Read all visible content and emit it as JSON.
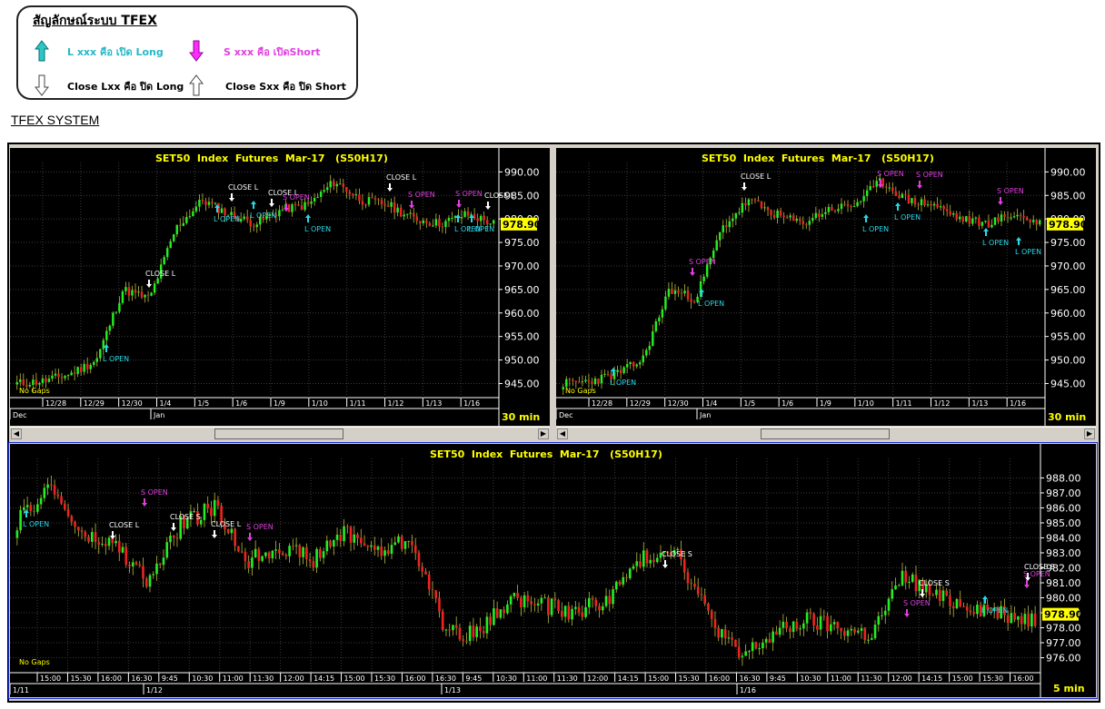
{
  "legend": {
    "title": "สัญลักษณ์ระบบ TFEX",
    "items": [
      {
        "text": "L xxx คือ เปิด Long",
        "color": "#27b8c8"
      },
      {
        "text": "S xxx คือ เปิดShort",
        "color": "#e040e0"
      },
      {
        "text": "Close Lxx คือ ปิด Long",
        "color": "#000000"
      },
      {
        "text": "Close Sxx คือ ปิด Short",
        "color": "#000000"
      }
    ],
    "icons": [
      "arrow-up-cyan-icon",
      "arrow-down-magenta-icon",
      "arrow-down-outline-icon",
      "arrow-up-outline-icon"
    ]
  },
  "section_title": "TFEX SYSTEM",
  "colors": {
    "up": "#22ee22",
    "down": "#ee2222",
    "grid": "#3a3a3a",
    "title": "#ffff00",
    "price_box": "#ffff00",
    "long": "#27d8e8",
    "short": "#e040e0",
    "close": "#ffffff"
  },
  "panels": [
    {
      "title": "SET50  Index  Futures  Mar-17   (S50H17)",
      "interval": "30  min",
      "no_gaps": "No  Gaps",
      "last_price": "978.90",
      "price_ticks": [
        "990.00",
        "985.00",
        "980.00",
        "975.00",
        "970.00",
        "965.00",
        "960.00",
        "955.00",
        "950.00",
        "945.00"
      ],
      "date_ticks": [
        "12/28",
        "12/29",
        "12/30",
        "1/4",
        "1/5",
        "1/6",
        "1/9",
        "1/10",
        "1/11",
        "1/12",
        "1/13",
        "1/16"
      ],
      "month_ticks": [
        "Dec",
        "Jan"
      ],
      "signals": [
        {
          "label": "L  OPEN",
          "type": "long"
        },
        {
          "label": "CLOSE  L",
          "type": "close"
        },
        {
          "label": "L  OPEN",
          "type": "long"
        },
        {
          "label": "CLOSE  L",
          "type": "close"
        },
        {
          "label": "L  OPEN",
          "type": "long"
        },
        {
          "label": "CLOSE  L",
          "type": "close"
        },
        {
          "label": "S  OPEN",
          "type": "short"
        },
        {
          "label": "L  OPEN",
          "type": "long"
        },
        {
          "label": "CLOSE  L",
          "type": "close"
        },
        {
          "label": "S  OPEN",
          "type": "short"
        },
        {
          "label": "S  OPEN",
          "type": "short"
        },
        {
          "label": "CLOSE  L",
          "type": "close"
        },
        {
          "label": "L  OPEN",
          "type": "long"
        },
        {
          "label": "L  OPEN",
          "type": "long"
        }
      ]
    },
    {
      "title": "SET50  Index  Futures  Mar-17   (S50H17)",
      "interval": "30  min",
      "no_gaps": "No  Gaps",
      "last_price": "978.90",
      "price_ticks": [
        "990.00",
        "985.00",
        "980.00",
        "975.00",
        "970.00",
        "965.00",
        "960.00",
        "955.00",
        "950.00",
        "945.00"
      ],
      "date_ticks": [
        "12/28",
        "12/29",
        "12/30",
        "1/4",
        "1/5",
        "1/6",
        "1/9",
        "1/10",
        "1/11",
        "1/12",
        "1/13",
        "1/16"
      ],
      "month_ticks": [
        "Dec",
        "Jan"
      ],
      "signals": [
        {
          "label": "L  OPEN",
          "type": "long"
        },
        {
          "label": "S  OPEN",
          "type": "short"
        },
        {
          "label": "L  OPEN",
          "type": "long"
        },
        {
          "label": "CLOSE  L",
          "type": "close"
        },
        {
          "label": "L  OPEN",
          "type": "long"
        },
        {
          "label": "S  OPEN",
          "type": "short"
        },
        {
          "label": "L  OPEN",
          "type": "long"
        },
        {
          "label": "S  OPEN",
          "type": "short"
        },
        {
          "label": "S  OPEN",
          "type": "short"
        },
        {
          "label": "L  OPEN",
          "type": "long"
        },
        {
          "label": "L  OPEN",
          "type": "long"
        }
      ]
    },
    {
      "title": "SET50  Index  Futures  Mar-17   (S50H17)",
      "interval": "5  min",
      "no_gaps": "No  Gaps",
      "last_price": "978.90",
      "price_ticks": [
        "988.00",
        "987.00",
        "986.00",
        "985.00",
        "984.00",
        "983.00",
        "982.00",
        "981.00",
        "980.00",
        "979.00",
        "978.00",
        "977.00",
        "976.00"
      ],
      "time_ticks": [
        "15:00",
        "15:30",
        "16:00",
        "16:30",
        "9:45",
        "10:30",
        "11:00",
        "11:30",
        "12:00",
        "14:15",
        "15:00",
        "15:30",
        "16:00",
        "16:30",
        "9:45",
        "10:30",
        "11:00",
        "11:30",
        "12:00",
        "14:15",
        "15:00",
        "15:30",
        "16:00",
        "16:30",
        "9:45",
        "10:30",
        "11:00",
        "11:30",
        "12:00",
        "14:15",
        "15:00",
        "15:30",
        "16:00"
      ],
      "day_ticks": [
        "1/11",
        "1/12",
        "1/13",
        "1/16"
      ],
      "signals": [
        {
          "label": "L  OPEN",
          "type": "long"
        },
        {
          "label": "CLOSE  L",
          "type": "close"
        },
        {
          "label": "S  OPEN",
          "type": "short"
        },
        {
          "label": "CLOSE  S",
          "type": "close"
        },
        {
          "label": "CLOSE  L",
          "type": "close"
        },
        {
          "label": "S  OPEN",
          "type": "short"
        },
        {
          "label": "CLOSE  S",
          "type": "close"
        },
        {
          "label": "S  OPEN",
          "type": "short"
        },
        {
          "label": "CLOSE  S",
          "type": "close"
        },
        {
          "label": "L  OPEN",
          "type": "long"
        },
        {
          "label": "CLOSE  S",
          "type": "close"
        },
        {
          "label": "S  OPEN",
          "type": "short"
        }
      ]
    }
  ]
}
